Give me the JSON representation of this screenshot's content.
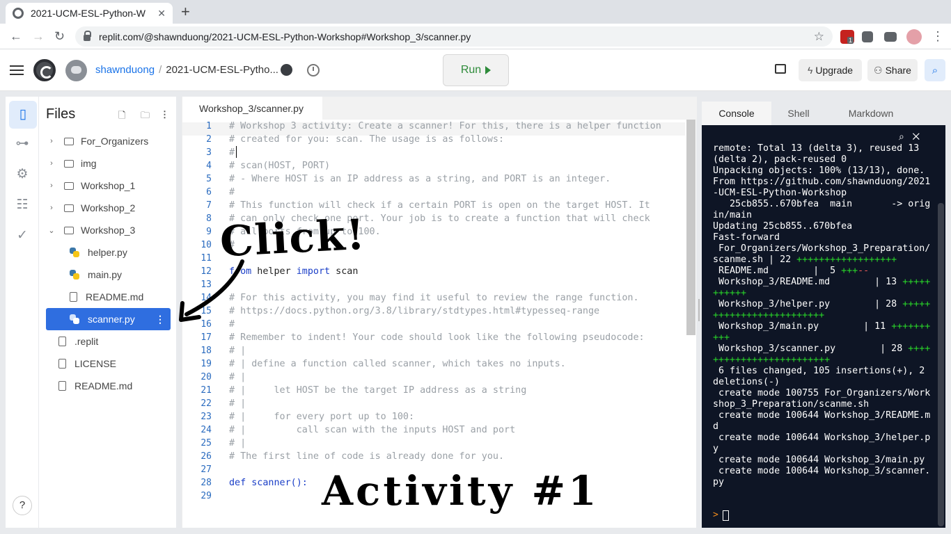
{
  "browser": {
    "tab_title": "2021-UCM-ESL-Python-W",
    "url": "replit.com/@shawnduong/2021-UCM-ESL-Python-Workshop#Workshop_3/scanner.py",
    "ext_badge": "1"
  },
  "header": {
    "user": "shawnduong",
    "separator": "/",
    "repl_name": "2021-UCM-ESL-Pytho...",
    "run_label": "Run",
    "upgrade_label": "Upgrade",
    "share_label": "Share"
  },
  "files": {
    "title": "Files",
    "items": [
      {
        "label": "For_Organizers",
        "type": "folder"
      },
      {
        "label": "img",
        "type": "folder"
      },
      {
        "label": "Workshop_1",
        "type": "folder"
      },
      {
        "label": "Workshop_2",
        "type": "folder"
      },
      {
        "label": "Workshop_3",
        "type": "folder-open"
      },
      {
        "label": "helper.py",
        "type": "py"
      },
      {
        "label": "main.py",
        "type": "py"
      },
      {
        "label": "README.md",
        "type": "file"
      },
      {
        "label": "scanner.py",
        "type": "py-selected"
      },
      {
        "label": ".replit",
        "type": "file"
      },
      {
        "label": "LICENSE",
        "type": "file"
      },
      {
        "label": "README.md",
        "type": "file"
      }
    ]
  },
  "editor": {
    "tab_label": "Workshop_3/scanner.py",
    "line_numbers": [
      "1",
      "2",
      "3",
      "4",
      "5",
      "6",
      "7",
      "8",
      "9",
      "10",
      "11",
      "12",
      "13",
      "14",
      "15",
      "16",
      "17",
      "18",
      "19",
      "20",
      "21",
      "22",
      "23",
      "24",
      "25",
      "26",
      "27",
      "28",
      "29"
    ],
    "lines": [
      "# Workshop 3 activity: Create a scanner! For this, there is a helper function",
      "# created for you: scan. The usage is as follows:",
      "#",
      "# scan(HOST, PORT)",
      "# - Where HOST is an IP address as a string, and PORT is an integer.",
      "#",
      "# This function will check if a certain PORT is open on the target HOST. It",
      "# can only check one port. Your job is to create a function that will check",
      "# all ports from up to 100.",
      "#",
      "",
      "from helper import scan",
      "",
      "# For this activity, you may find it useful to review the range function.",
      "# https://docs.python.org/3.8/library/stdtypes.html#typesseq-range",
      "#",
      "# Remember to indent! Your code should look like the following pseudocode:",
      "# |",
      "# | define a function called scanner, which takes no inputs.",
      "# |",
      "# |     let HOST be the target IP address as a string",
      "# |",
      "# |     for every port up to 100:",
      "# |         call scan with the inputs HOST and port",
      "# |",
      "# The first line of code is already done for you.",
      "",
      "def scanner():",
      ""
    ],
    "kw_from": "from",
    "kw_import": "import",
    "kw_def": "def",
    "helper": " helper ",
    "scan": " scan",
    "fn": " scanner():"
  },
  "right": {
    "tabs": [
      "Console",
      "Shell",
      "Markdown"
    ]
  },
  "console": {
    "lines": [
      "remote: Total 13 (delta 3), reused 13 (delta 2), pack-reused 0",
      "Unpacking objects: 100% (13/13), done.",
      "From https://github.com/shawnduong/2021-UCM-ESL-Python-Workshop",
      "   25cb855..670bfea  main       -> origin/main",
      "Updating 25cb855..670bfea",
      "Fast-forward",
      " For_Organizers/Workshop_3_Preparation/scanme.sh | 22 ",
      " README.md        |  5 ",
      " Workshop_3/README.md        | 13 ",
      " Workshop_3/helper.py        | 28 ",
      " Workshop_3/main.py        | 11 ",
      " Workshop_3/scanner.py        | 28 ",
      " 6 files changed, 105 insertions(+), 2 deletions(-)",
      " create mode 100755 For_Organizers/Workshop_3_Preparation/scanme.sh",
      " create mode 100644 Workshop_3/README.md",
      " create mode 100644 Workshop_3/helper.py",
      " create mode 100644 Workshop_3/main.py",
      " create mode 100644 Workshop_3/scanner.py"
    ],
    "plus22": "++++++++++++++++++",
    "plus5": "+++",
    "minus5": "--",
    "plus13": "+++++++++++",
    "plus28": "+++++++++++++++++++++++++",
    "plus11": "++++++++++",
    "prompt": ">"
  },
  "annotations": {
    "click": "Click!",
    "activity": "Activity #1"
  }
}
